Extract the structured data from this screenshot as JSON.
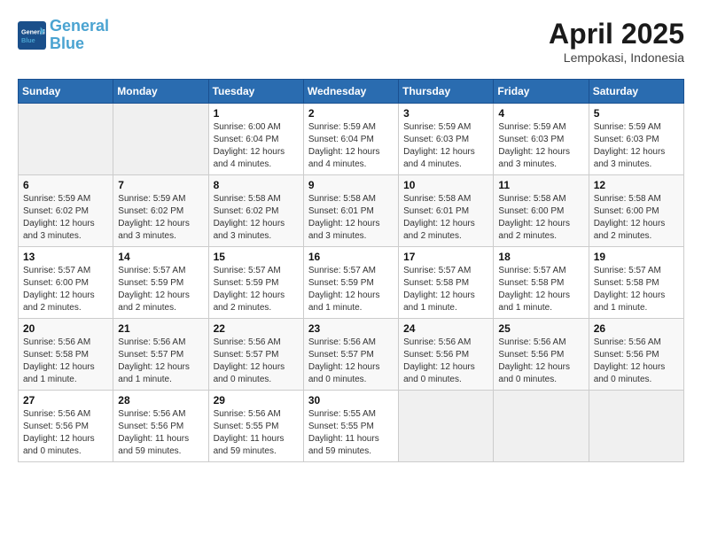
{
  "header": {
    "logo_line1": "General",
    "logo_line2": "Blue",
    "month_year": "April 2025",
    "location": "Lempokasi, Indonesia"
  },
  "days_of_week": [
    "Sunday",
    "Monday",
    "Tuesday",
    "Wednesday",
    "Thursday",
    "Friday",
    "Saturday"
  ],
  "weeks": [
    [
      {
        "day": "",
        "info": ""
      },
      {
        "day": "",
        "info": ""
      },
      {
        "day": "1",
        "info": "Sunrise: 6:00 AM\nSunset: 6:04 PM\nDaylight: 12 hours\nand 4 minutes."
      },
      {
        "day": "2",
        "info": "Sunrise: 5:59 AM\nSunset: 6:04 PM\nDaylight: 12 hours\nand 4 minutes."
      },
      {
        "day": "3",
        "info": "Sunrise: 5:59 AM\nSunset: 6:03 PM\nDaylight: 12 hours\nand 4 minutes."
      },
      {
        "day": "4",
        "info": "Sunrise: 5:59 AM\nSunset: 6:03 PM\nDaylight: 12 hours\nand 3 minutes."
      },
      {
        "day": "5",
        "info": "Sunrise: 5:59 AM\nSunset: 6:03 PM\nDaylight: 12 hours\nand 3 minutes."
      }
    ],
    [
      {
        "day": "6",
        "info": "Sunrise: 5:59 AM\nSunset: 6:02 PM\nDaylight: 12 hours\nand 3 minutes."
      },
      {
        "day": "7",
        "info": "Sunrise: 5:59 AM\nSunset: 6:02 PM\nDaylight: 12 hours\nand 3 minutes."
      },
      {
        "day": "8",
        "info": "Sunrise: 5:58 AM\nSunset: 6:02 PM\nDaylight: 12 hours\nand 3 minutes."
      },
      {
        "day": "9",
        "info": "Sunrise: 5:58 AM\nSunset: 6:01 PM\nDaylight: 12 hours\nand 3 minutes."
      },
      {
        "day": "10",
        "info": "Sunrise: 5:58 AM\nSunset: 6:01 PM\nDaylight: 12 hours\nand 2 minutes."
      },
      {
        "day": "11",
        "info": "Sunrise: 5:58 AM\nSunset: 6:00 PM\nDaylight: 12 hours\nand 2 minutes."
      },
      {
        "day": "12",
        "info": "Sunrise: 5:58 AM\nSunset: 6:00 PM\nDaylight: 12 hours\nand 2 minutes."
      }
    ],
    [
      {
        "day": "13",
        "info": "Sunrise: 5:57 AM\nSunset: 6:00 PM\nDaylight: 12 hours\nand 2 minutes."
      },
      {
        "day": "14",
        "info": "Sunrise: 5:57 AM\nSunset: 5:59 PM\nDaylight: 12 hours\nand 2 minutes."
      },
      {
        "day": "15",
        "info": "Sunrise: 5:57 AM\nSunset: 5:59 PM\nDaylight: 12 hours\nand 2 minutes."
      },
      {
        "day": "16",
        "info": "Sunrise: 5:57 AM\nSunset: 5:59 PM\nDaylight: 12 hours\nand 1 minute."
      },
      {
        "day": "17",
        "info": "Sunrise: 5:57 AM\nSunset: 5:58 PM\nDaylight: 12 hours\nand 1 minute."
      },
      {
        "day": "18",
        "info": "Sunrise: 5:57 AM\nSunset: 5:58 PM\nDaylight: 12 hours\nand 1 minute."
      },
      {
        "day": "19",
        "info": "Sunrise: 5:57 AM\nSunset: 5:58 PM\nDaylight: 12 hours\nand 1 minute."
      }
    ],
    [
      {
        "day": "20",
        "info": "Sunrise: 5:56 AM\nSunset: 5:58 PM\nDaylight: 12 hours\nand 1 minute."
      },
      {
        "day": "21",
        "info": "Sunrise: 5:56 AM\nSunset: 5:57 PM\nDaylight: 12 hours\nand 1 minute."
      },
      {
        "day": "22",
        "info": "Sunrise: 5:56 AM\nSunset: 5:57 PM\nDaylight: 12 hours\nand 0 minutes."
      },
      {
        "day": "23",
        "info": "Sunrise: 5:56 AM\nSunset: 5:57 PM\nDaylight: 12 hours\nand 0 minutes."
      },
      {
        "day": "24",
        "info": "Sunrise: 5:56 AM\nSunset: 5:56 PM\nDaylight: 12 hours\nand 0 minutes."
      },
      {
        "day": "25",
        "info": "Sunrise: 5:56 AM\nSunset: 5:56 PM\nDaylight: 12 hours\nand 0 minutes."
      },
      {
        "day": "26",
        "info": "Sunrise: 5:56 AM\nSunset: 5:56 PM\nDaylight: 12 hours\nand 0 minutes."
      }
    ],
    [
      {
        "day": "27",
        "info": "Sunrise: 5:56 AM\nSunset: 5:56 PM\nDaylight: 12 hours\nand 0 minutes."
      },
      {
        "day": "28",
        "info": "Sunrise: 5:56 AM\nSunset: 5:56 PM\nDaylight: 11 hours\nand 59 minutes."
      },
      {
        "day": "29",
        "info": "Sunrise: 5:56 AM\nSunset: 5:55 PM\nDaylight: 11 hours\nand 59 minutes."
      },
      {
        "day": "30",
        "info": "Sunrise: 5:55 AM\nSunset: 5:55 PM\nDaylight: 11 hours\nand 59 minutes."
      },
      {
        "day": "",
        "info": ""
      },
      {
        "day": "",
        "info": ""
      },
      {
        "day": "",
        "info": ""
      }
    ]
  ]
}
